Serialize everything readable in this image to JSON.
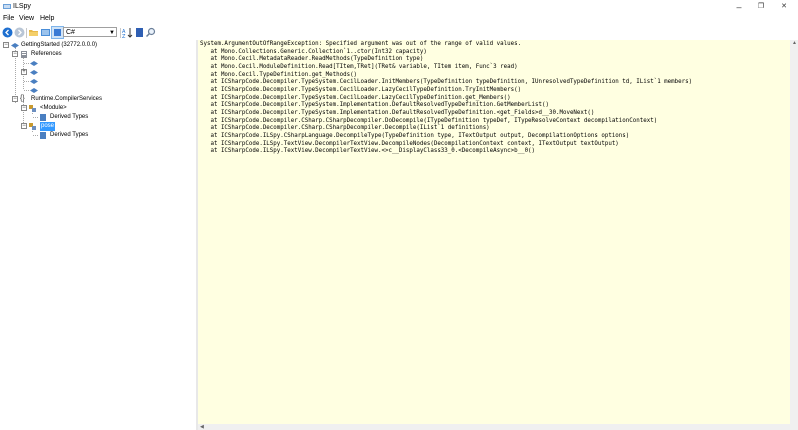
{
  "window": {
    "title": "ILSpy",
    "minimize": "–",
    "restore": "❐",
    "close": "✕"
  },
  "menu": {
    "file": "File",
    "view": "View",
    "help": "Help"
  },
  "toolbar": {
    "language": "C#"
  },
  "tree": {
    "root": "GettingStarted (32772.0.0.0)",
    "references": "References",
    "namespace": "Runtime.CompilerServices",
    "module": "<Module>",
    "module_derived": "Derived Types",
    "selected_type": "pose",
    "pose_derived": "Derived Types"
  },
  "output": {
    "lines": [
      "System.ArgumentOutOfRangeException: Specified argument was out of the range of valid values.",
      "   at Mono.Collections.Generic.Collection`1..ctor(Int32 capacity)",
      "   at Mono.Cecil.MetadataReader.ReadMethods(TypeDefinition type)",
      "   at Mono.Cecil.ModuleDefinition.Read[TItem,TRet](TRet& variable, TItem item, Func`3 read)",
      "   at Mono.Cecil.TypeDefinition.get_Methods()",
      "   at ICSharpCode.Decompiler.TypeSystem.CecilLoader.InitMembers(TypeDefinition typeDefinition, IUnresolvedTypeDefinition td, IList`1 members)",
      "   at ICSharpCode.Decompiler.TypeSystem.CecilLoader.LazyCecilTypeDefinition.TryInitMembers()",
      "   at ICSharpCode.Decompiler.TypeSystem.CecilLoader.LazyCecilTypeDefinition.get_Members()",
      "   at ICSharpCode.Decompiler.TypeSystem.Implementation.DefaultResolvedTypeDefinition.GetMemberList()",
      "   at ICSharpCode.Decompiler.TypeSystem.Implementation.DefaultResolvedTypeDefinition.<get_Fields>d__30.MoveNext()",
      "   at ICSharpCode.Decompiler.CSharp.CSharpDecompiler.DoDecompile(ITypeDefinition typeDef, ITypeResolveContext decompilationContext)",
      "   at ICSharpCode.Decompiler.CSharp.CSharpDecompiler.Decompile(IList`1 definitions)",
      "   at ICSharpCode.ILSpy.CSharpLanguage.DecompileType(TypeDefinition type, ITextOutput output, DecompilationOptions options)",
      "   at ICSharpCode.ILSpy.TextView.DecompilerTextView.DecompileNodes(DecompilationContext context, ITextOutput textOutput)",
      "   at ICSharpCode.ILSpy.TextView.DecompilerTextView.<>c__DisplayClass33_0.<DecompileAsync>b__0()"
    ]
  },
  "colors": {
    "output_bg": "#ffffe1",
    "selection": "#3399ff",
    "accent_blue": "#1e6fd0"
  }
}
